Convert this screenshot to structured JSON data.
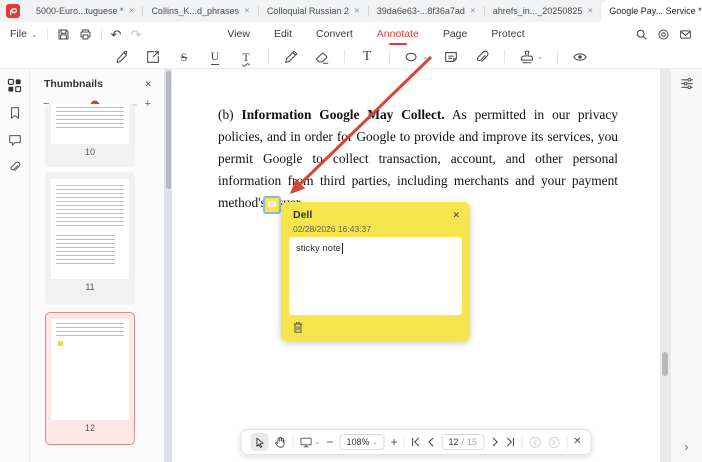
{
  "app": {
    "badge_count": "6"
  },
  "glyphs": {
    "caret": "⌄",
    "close": "✕",
    "minus": "−",
    "plus": "+",
    "undo": "↶",
    "redo": "↷",
    "menu": "≡",
    "minimize": "—",
    "maximize": "□",
    "chevron_right": "›",
    "new_tab": "+"
  },
  "tabs": {
    "items": [
      {
        "label": "5000-Euro...tuguese *"
      },
      {
        "label": "Collins_K...d_phrases"
      },
      {
        "label": "Colloquial Russian 2"
      },
      {
        "label": "39da6e63-...8f36a7ad"
      },
      {
        "label": "ahrefs_in..._20250825"
      },
      {
        "label": "Google Pay... Service *"
      }
    ]
  },
  "menubar": {
    "file_label": "File",
    "items": [
      {
        "label": "View"
      },
      {
        "label": "Edit"
      },
      {
        "label": "Convert"
      },
      {
        "label": "Annotate"
      },
      {
        "label": "Page"
      },
      {
        "label": "Protect"
      }
    ],
    "active_item": "Annotate"
  },
  "toolbar": {
    "tools": [
      "highlight",
      "area-highlight",
      "strikethrough",
      "underline",
      "squiggly-underline",
      "pencil",
      "eraser",
      "text-comment",
      "shapes",
      "sticky-note",
      "attachment",
      "stamp",
      "preview-eye"
    ],
    "letter_strike": "S",
    "letter_underline": "U",
    "letter_squiggly": "T",
    "letter_text": "T"
  },
  "sidebar": {
    "panel_title": "Thumbnails",
    "rail_icons": [
      "thumbnails-icon",
      "bookmark-icon",
      "comment-icon",
      "attachment-icon"
    ],
    "thumbnails": [
      {
        "page": "10"
      },
      {
        "page": "11"
      },
      {
        "page": "12",
        "selected": true
      }
    ],
    "selected_page": "12"
  },
  "document": {
    "paragraph_prefix": "(b) ",
    "paragraph_bold": "Information Google May Collect.",
    "paragraph_rest": " As permitted in our privacy policies, and in order for Google to provide and improve its services, you permit Google to collect transaction, account, and other personal information from third parties, including merchants and your payment method's issuer."
  },
  "sticky_note": {
    "author": "Dell",
    "timestamp": "02/28/2026 16:43:37",
    "text": "sticky note"
  },
  "bottom_toolbar": {
    "zoom_value": "108%",
    "current_page": "12",
    "page_separator": "/",
    "total_pages": "15"
  },
  "colors": {
    "accent_red": "#e4392f",
    "note_yellow": "#f7e54d",
    "selection_blue": "#8ab9ea",
    "thumb_selected_border": "#e88c80"
  }
}
